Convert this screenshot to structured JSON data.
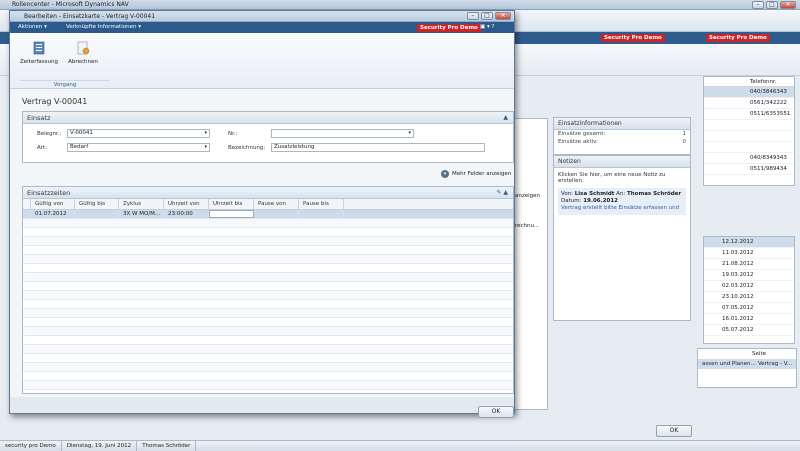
{
  "background_window": {
    "title": "Rollencenter - Microsoft Dynamics NAV",
    "security_badge": "Security Pro Demo",
    "phone_header": "Telefonnr.",
    "phones": [
      "040/3846343",
      "0561/342222",
      "0511/6353551",
      "040/8349343",
      "0511/989434"
    ],
    "dates": [
      "12.12.2012",
      "11.03.2012",
      "21.08.2012",
      "19.03.2012",
      "02.03.2012",
      "23.10.2012",
      "07.05.2012",
      "16.01.2012",
      "05.07.2012"
    ],
    "seite_label": "Seite",
    "bottom_row_left": "assen und Planen...",
    "bottom_row_right": "Vertrag - V...",
    "ok_label": "OK",
    "partial_label_1": "r anzeigen",
    "partial_label_2": "rechnu..."
  },
  "status_bar": {
    "company": "security pro Demo",
    "date": "Dienstag, 19. Juni 2012",
    "user": "Thomas Schröder"
  },
  "dialog": {
    "title": "Bearbeiten - Einsatzkarte - Vertrag V-00041",
    "menu": {
      "actions": "Aktionen",
      "linked_info": "Verknüpfte Informationen"
    },
    "security_badge": "Security Pro Demo",
    "ribbon": {
      "btn_time_entry": "Zeiterfassung",
      "btn_billing": "Abrechnen",
      "group": "Vorgang"
    },
    "doc_title": "Vertrag V-00041",
    "einsatz": {
      "header": "Einsatz",
      "beleg_label": "Belegnr.:",
      "beleg_value": "V-00041",
      "art_label": "Art:",
      "art_value": "Bedarf",
      "nr_label": "Nr.:",
      "nr_value": "",
      "bez_label": "Bezeichnung:",
      "bez_value": "Zusatzleistung",
      "more_fields": "Mehr Felder anzeigen"
    },
    "einsatzzeiten": {
      "header": "Einsatzzeiten",
      "columns": [
        "Gültig von",
        "Gültig bis",
        "Zyklus",
        "Uhrzeit von",
        "Uhrzeit bis",
        "Pause von",
        "Pause bis"
      ],
      "rows": [
        [
          "01.07.2012",
          "",
          "3X W MO/M...",
          "23:00:00",
          "",
          "",
          ""
        ]
      ]
    },
    "ok_label": "OK"
  },
  "einsatzinfo": {
    "header": "Einsatzinformationen",
    "total_label": "Einsätze gesamt:",
    "total_value": "1",
    "active_label": "Einsätze aktiv:",
    "active_value": "0"
  },
  "notizen": {
    "header": "Notizen",
    "hint": "Klicken Sie hier, um eine neue Notiz zu erstellen.",
    "from_label": "Von:",
    "from_value": "Lisa Schmidt",
    "to_label": "An:",
    "to_value": "Thomas Schröder",
    "date_label": "Datum:",
    "date_value": "19.06.2012",
    "text": "Vertrag erstellt bitte Einsätze erfassen und"
  }
}
